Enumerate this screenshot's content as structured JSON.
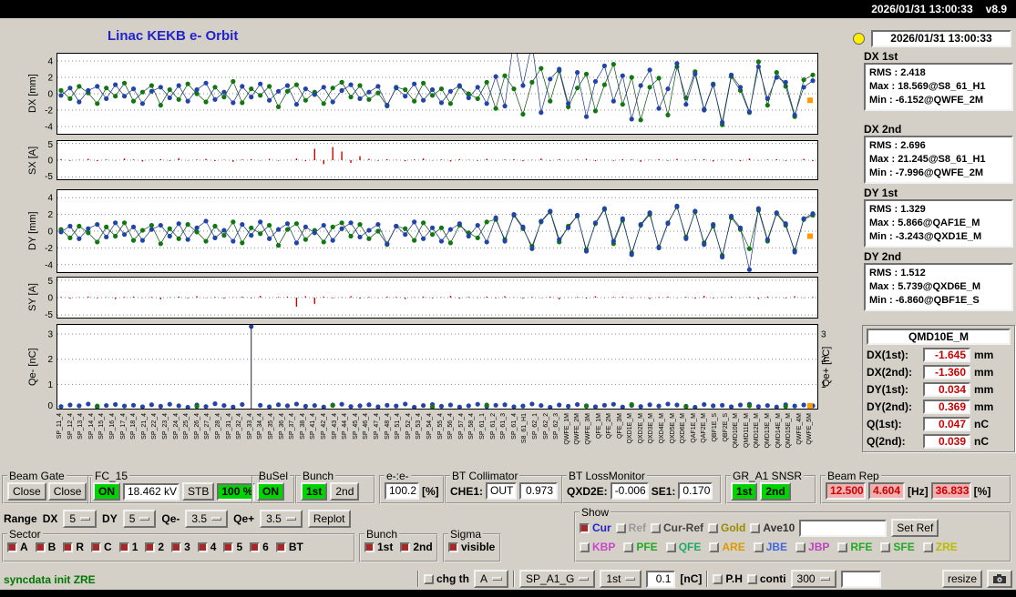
{
  "window": {
    "datetime": "2026/01/31 13:00:33",
    "version": "v8.9"
  },
  "header": {
    "title": "Linac KEKB e- Orbit",
    "timestamp": "2026/01/31 13:00:33"
  },
  "stats": [
    {
      "label": "DX 1st",
      "rows": [
        {
          "k": "RMS :",
          "v": "2.418"
        },
        {
          "k": "Max :",
          "v": "18.569@S8_61_H1"
        },
        {
          "k": "Min :",
          "v": "-6.152@QWFE_2M"
        }
      ]
    },
    {
      "label": "DX 2nd",
      "rows": [
        {
          "k": "RMS :",
          "v": "2.696"
        },
        {
          "k": "Max :",
          "v": "21.245@S8_61_H1"
        },
        {
          "k": "Min :",
          "v": "-7.996@QWFE_2M"
        }
      ]
    },
    {
      "label": "DY 1st",
      "rows": [
        {
          "k": "RMS :",
          "v": "1.329"
        },
        {
          "k": "Max :",
          "v": "5.866@QAF1E_M"
        },
        {
          "k": "Min :",
          "v": "-3.243@QXD1E_M"
        }
      ]
    },
    {
      "label": "DY 2nd",
      "rows": [
        {
          "k": "RMS :",
          "v": "1.512"
        },
        {
          "k": "Max :",
          "v": "5.739@QXD6E_M"
        },
        {
          "k": "Min :",
          "v": "-6.860@QBF1E_S"
        }
      ]
    }
  ],
  "monitor": {
    "title": "QMD10E_M",
    "rows": [
      {
        "label": "DX(1st):",
        "value": "-1.645",
        "unit": "mm"
      },
      {
        "label": "DX(2nd):",
        "value": "-1.360",
        "unit": "mm"
      },
      {
        "label": "DY(1st):",
        "value": "0.034",
        "unit": "mm"
      },
      {
        "label": "DY(2nd):",
        "value": "0.369",
        "unit": "mm"
      },
      {
        "label": "Q(1st):",
        "value": "0.047",
        "unit": "nC"
      },
      {
        "label": "Q(2nd):",
        "value": "0.039",
        "unit": "nC"
      }
    ]
  },
  "chart_data": [
    {
      "id": "dx",
      "type": "scatter",
      "ylabel": "DX [mm]",
      "ylim": [
        -5,
        5
      ],
      "yticks": [
        4,
        2,
        0,
        -2,
        -4
      ],
      "grid": "dotted-horizontal",
      "end_marker": -0.8,
      "series": [
        {
          "name": "1st",
          "color": "#117711",
          "line": "#0b4d0b",
          "values": [
            0.4,
            -0.6,
            0.9,
            0.1,
            -1.2,
            0.7,
            -0.3,
            1.3,
            -0.9,
            0.2,
            1.0,
            -1.4,
            0.5,
            -0.7,
            1.2,
            0.0,
            -1.0,
            0.8,
            -0.4,
            1.5,
            -1.1,
            0.6,
            -0.2,
            0.9,
            -1.6,
            0.3,
            1.1,
            -0.8,
            0.2,
            -1.2,
            0.7,
            1.4,
            -0.4,
            1.0,
            -0.7,
            0.1,
            -1.5,
            0.8,
            0.5,
            -0.9,
            1.3,
            -0.2,
            0.6,
            -1.2,
            0.9,
            0.0,
            -0.6,
            1.4,
            -1.8,
            2.2,
            0.6,
            -2.5,
            1.4,
            3.1,
            -0.9,
            2.8,
            -1.6,
            0.7,
            2.4,
            -2.1,
            1.1,
            3.6,
            -1.3,
            2.0,
            -3.2,
            0.8,
            1.9,
            -2.6,
            3.3,
            -0.5,
            2.7,
            -1.9,
            1.2,
            -3.8,
            2.1,
            0.4,
            -2.3,
            3.9,
            -1.4,
            2.6,
            0.9,
            -2.8,
            1.7,
            2.3
          ]
        },
        {
          "name": "2nd",
          "color": "#2244aa",
          "line": "#1a3380",
          "values": [
            -0.2,
            0.7,
            -1.0,
            0.4,
            0.9,
            -0.6,
            1.1,
            -0.3,
            0.6,
            -1.2,
            0.3,
            0.8,
            -0.5,
            1.0,
            -0.9,
            0.5,
            1.3,
            -0.7,
            0.2,
            -1.1,
            0.9,
            -0.4,
            1.2,
            -0.8,
            0.3,
            1.0,
            -1.3,
            0.6,
            -0.1,
            0.8,
            -1.0,
            0.4,
            1.1,
            -0.6,
            0.2,
            0.9,
            -1.4,
            0.7,
            -0.3,
            1.2,
            -0.8,
            0.5,
            -1.1,
            0.3,
            1.0,
            -0.5,
            0.8,
            -1.2,
            2.1,
            -1.5,
            6.8,
            1.0,
            6.2,
            -2.3,
            1.8,
            3.0,
            -1.2,
            2.6,
            -2.8,
            1.5,
            3.4,
            -0.9,
            2.2,
            -3.1,
            1.0,
            2.9,
            -1.8,
            0.6,
            3.7,
            -1.3,
            2.4,
            -2.0,
            1.1,
            -3.5,
            2.3,
            0.8,
            -2.2,
            3.3,
            -0.6,
            2.0,
            1.4,
            -2.6,
            0.8,
            1.6
          ]
        }
      ]
    },
    {
      "id": "sx",
      "type": "bar",
      "ylabel": "SX [A]",
      "ylim": [
        -6,
        6
      ],
      "yticks": [
        5,
        0,
        -5
      ],
      "color": "#cc0000",
      "values": [
        0.3,
        -0.2,
        0.1,
        0.4,
        -0.3,
        0.2,
        -0.1,
        0.5,
        0.2,
        -0.4,
        0.1,
        0.3,
        -0.2,
        0.6,
        -0.1,
        0.2,
        0.4,
        -0.3,
        0.1,
        -0.5,
        0.2,
        0.3,
        -0.1,
        0.4,
        -0.2,
        0.1,
        0.5,
        -0.3,
        3.4,
        -1.2,
        3.9,
        2.6,
        -0.8,
        1.2,
        0.4,
        -0.2,
        0.3,
        0.1,
        -0.3,
        0.2,
        0.5,
        -0.1,
        0.2,
        -0.4,
        0.3,
        0.1,
        -0.2,
        0.4,
        -0.1,
        0.2,
        0.3,
        -0.3,
        0.1,
        0.5,
        -0.2,
        0.3,
        -0.1,
        0.2,
        0.4,
        -0.3,
        0.1,
        -0.2,
        0.3,
        0.2,
        -0.5,
        0.1,
        0.3,
        -0.2,
        0.4,
        -0.1,
        0.2,
        0.3,
        -0.4,
        0.1,
        0.2,
        -0.3,
        0.5,
        -0.1,
        0.2,
        0.3,
        -0.2,
        0.1,
        0.4,
        -0.3
      ]
    },
    {
      "id": "dy",
      "type": "scatter",
      "ylabel": "DY [mm]",
      "ylim": [
        -5,
        5
      ],
      "yticks": [
        4,
        2,
        0,
        -2,
        -4
      ],
      "grid": "dotted-horizontal",
      "end_marker": -0.6,
      "series": [
        {
          "name": "1st",
          "color": "#117711",
          "line": "#0b4d0b",
          "values": [
            0.2,
            -0.8,
            0.6,
            -0.2,
            -1.3,
            0.5,
            -0.6,
            1.0,
            -1.1,
            0.1,
            0.7,
            -1.5,
            0.3,
            -0.9,
            0.8,
            -0.1,
            -1.2,
            0.6,
            -0.5,
            1.1,
            -1.4,
            0.4,
            -0.3,
            0.7,
            -1.7,
            0.2,
            0.9,
            -1.0,
            0.1,
            -1.3,
            0.5,
            1.0,
            -0.6,
            0.8,
            -0.9,
            0.0,
            -1.6,
            0.6,
            0.3,
            -1.1,
            1.0,
            -0.4,
            0.4,
            -1.4,
            0.7,
            -0.2,
            -0.8,
            1.1,
            1.4,
            -1.0,
            1.9,
            0.3,
            -1.8,
            1.1,
            2.3,
            -1.3,
            0.6,
            1.8,
            -2.2,
            0.9,
            2.6,
            -1.5,
            1.3,
            -2.6,
            0.7,
            2.0,
            -1.9,
            1.0,
            2.9,
            -0.7,
            2.3,
            -1.4,
            0.6,
            -2.9,
            1.6,
            0.2,
            -2.1,
            2.5,
            -1.2,
            2.1,
            0.7,
            -2.3,
            1.4,
            1.9
          ]
        },
        {
          "name": "2nd",
          "color": "#2244aa",
          "line": "#1a3380",
          "values": [
            -0.1,
            0.6,
            -0.9,
            0.3,
            0.8,
            -0.7,
            1.0,
            -0.4,
            0.5,
            -1.1,
            0.2,
            0.7,
            -0.6,
            0.9,
            -1.0,
            0.4,
            1.2,
            -0.8,
            0.1,
            -1.2,
            0.8,
            -0.5,
            1.1,
            -0.9,
            0.2,
            0.9,
            -1.4,
            0.5,
            -0.2,
            0.7,
            -1.1,
            0.3,
            1.0,
            -0.7,
            0.1,
            0.8,
            -1.5,
            0.6,
            -0.4,
            1.1,
            -0.9,
            0.4,
            -1.2,
            0.2,
            0.9,
            -0.6,
            0.7,
            -1.3,
            1.6,
            -1.2,
            2.0,
            0.5,
            -2.1,
            1.2,
            2.4,
            -1.0,
            0.4,
            1.9,
            -2.4,
            1.0,
            2.7,
            -1.2,
            1.5,
            -2.8,
            0.8,
            2.2,
            -2.0,
            0.9,
            3.0,
            -0.9,
            2.4,
            -1.6,
            0.8,
            -3.1,
            1.8,
            0.4,
            -4.6,
            2.7,
            -1.0,
            2.2,
            0.9,
            -2.5,
            1.5,
            2.1
          ]
        }
      ]
    },
    {
      "id": "sy",
      "type": "bar",
      "ylabel": "SY [A]",
      "ylim": [
        -6,
        6
      ],
      "yticks": [
        5,
        0,
        -5
      ],
      "color": "#cc0000",
      "values": [
        0.2,
        -0.3,
        0.1,
        0.3,
        -0.2,
        0.1,
        -0.4,
        0.2,
        0.3,
        -0.1,
        0.2,
        -0.5,
        0.1,
        0.3,
        -0.2,
        0.4,
        -0.1,
        0.2,
        -0.3,
        0.1,
        0.3,
        -0.2,
        0.5,
        -0.1,
        0.2,
        0.3,
        -2.6,
        0.4,
        -1.8,
        0.3,
        -0.2,
        0.1,
        0.4,
        -0.3,
        0.2,
        -0.1,
        0.3,
        0.2,
        -0.4,
        0.1,
        0.3,
        -0.2,
        0.1,
        0.5,
        -0.3,
        0.2,
        -0.1,
        0.3,
        -0.2,
        0.4,
        0.1,
        -0.3,
        0.2,
        -0.1,
        0.3,
        -0.5,
        0.1,
        0.2,
        -0.3,
        0.4,
        -0.1,
        0.2,
        0.3,
        -0.2,
        0.1,
        -0.4,
        0.2,
        0.3,
        -0.1,
        0.2,
        -0.3,
        0.5,
        -0.2,
        0.1,
        0.3,
        -0.1,
        0.2,
        -0.4,
        0.3,
        0.1,
        -0.2,
        0.4,
        -0.1,
        0.2
      ]
    },
    {
      "id": "q",
      "type": "scatter",
      "ylabel": "Qe- [nC]",
      "ylabel_right": "Qe+ [nC]",
      "ylim": [
        0,
        3.4
      ],
      "yticks": [
        3,
        2,
        1,
        0
      ],
      "yticks_right": [
        3,
        2,
        1
      ],
      "end_marker": 0.15,
      "spikes": [
        [
          21,
          3.3
        ]
      ],
      "series": [
        {
          "name": "e- charge",
          "color": "#2244aa",
          "line": null,
          "values": [
            0.12,
            0.18,
            0.15,
            0.22,
            0.1,
            0.16,
            0.2,
            0.14,
            0.17,
            0.11,
            0.19,
            0.13,
            0.21,
            0.15,
            0.09,
            0.18,
            0.12,
            0.23,
            0.16,
            0.1,
            0.2,
            3.3,
            0.17,
            0.11,
            0.19,
            0.15,
            0.22,
            0.13,
            0.16,
            0.1,
            0.18,
            0.21,
            0.12,
            0.15,
            0.19,
            0.11,
            0.17,
            0.14,
            0.22,
            0.09,
            0.16,
            0.2,
            0.13,
            0.18,
            0.1,
            0.15,
            0.21,
            0.12,
            0.17,
            0.19,
            0.11,
            0.14,
            0.22,
            0.16,
            0.09,
            0.18,
            0.13,
            0.2,
            0.15,
            0.11,
            0.17,
            0.21,
            0.1,
            0.16,
            0.12,
            0.19,
            0.14,
            0.22,
            0.18,
            0.13,
            0.09,
            0.2,
            0.15,
            0.17,
            0.11,
            0.18,
            0.21,
            0.12,
            0.16,
            0.1,
            0.19,
            0.14,
            0.18,
            0.15
          ]
        },
        {
          "name": "e+ charge",
          "color": "#117711",
          "points": [
            [
              4,
              0.14
            ],
            [
              15,
              0.12
            ],
            [
              30,
              0.16
            ],
            [
              41,
              0.1
            ],
            [
              47,
              0.18
            ],
            [
              58,
              0.13
            ],
            [
              63,
              0.2
            ],
            [
              69,
              0.11
            ],
            [
              76,
              0.15
            ],
            [
              80,
              0.12
            ]
          ]
        }
      ]
    }
  ],
  "x_axis_labels": [
    "SP_11_4",
    "SP_12_4",
    "SP_13_4",
    "SP_14_4",
    "SP_15_4",
    "SP_16_4",
    "SP_17_4",
    "SP_18_4",
    "SP_21_4",
    "SP_22_4",
    "SP_23_4",
    "SP_24_4",
    "SP_25_4",
    "SP_26_4",
    "SP_27_4",
    "SP_28_4",
    "SP_31_4",
    "SP_32_4",
    "SP_33_4",
    "SP_34_4",
    "SP_35_4",
    "SP_36_4",
    "SP_37_4",
    "SP_38_4",
    "SP_41_4",
    "SP_42_4",
    "SP_43_4",
    "SP_44_4",
    "SP_45_4",
    "SP_46_4",
    "SP_47_4",
    "SP_48_4",
    "SP_51_4",
    "SP_52_4",
    "SP_53_4",
    "SP_54_4",
    "SP_55_4",
    "SP_56_4",
    "SP_57_4",
    "SP_58_4",
    "SP_61_1",
    "SP_61_2",
    "SP_61_3",
    "SP_61_4",
    "S8_61_H1",
    "SP_62_1",
    "SP_62_2",
    "SP_62_3",
    "QWFE_1M",
    "QWFE_2M",
    "QWFE_3M",
    "QFE_1M",
    "QFE_2M",
    "QFE_3M",
    "QXD1E_M",
    "QXD2E_M",
    "QXD3E_M",
    "QXD4E_M",
    "QXD5E_M",
    "QXD6E_M",
    "QAF1E_M",
    "QAF2E_M",
    "QBF1E_S",
    "QBF2E_S",
    "QMD10E_M",
    "QMD11E_M",
    "QMD12E_M",
    "QMD13E_M",
    "QMD14E_M",
    "QMD15E_M",
    "QWFE_4M",
    "QWFE_5M"
  ],
  "controls": {
    "beam_gate": {
      "title": "Beam Gate",
      "buttons": [
        "Close",
        "Close"
      ]
    },
    "fc15": {
      "title": "FC_15",
      "on": "ON",
      "voltage": "18.462 kV",
      "stb": "STB",
      "duty": "100 %"
    },
    "busel": {
      "title": "BuSel",
      "on": "ON"
    },
    "bunch": {
      "title": "Bunch",
      "first": "1st",
      "second": "2nd"
    },
    "ee": {
      "title": "e-:e-",
      "value": "100.2",
      "unit": "[%]"
    },
    "bt_collimator": {
      "title": "BT Collimator",
      "che1_label": "CHE1:",
      "che1_value": "OUT",
      "extra": "0.973"
    },
    "bt_lossmonitor": {
      "title": "BT LossMonitor",
      "qxd2e_label": "QXD2E:",
      "qxd2e_value": "-0.006",
      "se1_label": "SE1:",
      "se1_value": "0.170"
    },
    "gr_a1_snsr": {
      "title": "GR_A1 SNSR",
      "first": "1st",
      "second": "2nd"
    },
    "beam_rep": {
      "title": "Beam Rep",
      "rep1": "12.500",
      "rep2": "4.604",
      "hz_label": "[Hz]",
      "duty": "36.833",
      "pct_label": "[%]"
    }
  },
  "range": {
    "label": "Range",
    "items": [
      {
        "label": "DX",
        "value": "5"
      },
      {
        "label": "DY",
        "value": "5"
      },
      {
        "label": "Qe-",
        "value": "3.5"
      },
      {
        "label": "Qe+",
        "value": "3.5"
      }
    ],
    "replot": "Replot"
  },
  "sector": {
    "title": "Sector",
    "items": [
      "A",
      "B",
      "R",
      "C",
      "1",
      "2",
      "3",
      "4",
      "5",
      "6",
      "BT"
    ]
  },
  "bunch_sel": {
    "title": "Bunch",
    "items": [
      "1st",
      "2nd"
    ]
  },
  "sigma": {
    "title": "Sigma",
    "label": "visible"
  },
  "show": {
    "title": "Show",
    "row1": [
      {
        "label": "Cur",
        "checked": true,
        "color": "#2222cc"
      },
      {
        "label": "Ref",
        "checked": false,
        "color": "#999999"
      },
      {
        "label": "Cur-Ref",
        "checked": false,
        "color": "#444444"
      },
      {
        "label": "Gold",
        "checked": false,
        "color": "#998800"
      },
      {
        "label": "Ave10",
        "checked": false,
        "color": "#333333"
      }
    ],
    "ref_input": "",
    "set_ref": "Set Ref",
    "row2": [
      {
        "label": "KBP",
        "color": "#cc44cc"
      },
      {
        "label": "PFE",
        "color": "#22aa22"
      },
      {
        "label": "QFE",
        "color": "#22aa66"
      },
      {
        "label": "ARE",
        "color": "#dd9900"
      },
      {
        "label": "JBE",
        "color": "#4466dd"
      },
      {
        "label": "JBP",
        "color": "#bb44bb"
      },
      {
        "label": "RFE",
        "color": "#22aa22"
      },
      {
        "label": "SFE",
        "color": "#22aa22"
      },
      {
        "label": "ZRE",
        "color": "#bbbb00"
      }
    ]
  },
  "statusbar": {
    "message": "syncdata init ZRE"
  },
  "bottom": {
    "chg_th": "chg th",
    "mode": "A",
    "group": "SP_A1_G",
    "bunch": "1st",
    "threshold": "0.1",
    "unit": "[nC]",
    "ph": "P.H",
    "conti": "conti",
    "count": "300",
    "entry": "",
    "resize": "resize"
  },
  "colors": {
    "accent_green": "#00d400",
    "alarm_pink": "#f0b0b0",
    "value_red": "#cc0000",
    "series_green": "#117711",
    "series_blue": "#2244aa",
    "steering_red": "#cc0000",
    "marker_orange": "#ff9900",
    "lamp_yellow": "#ffee00",
    "title_blue": "#2222cc"
  }
}
